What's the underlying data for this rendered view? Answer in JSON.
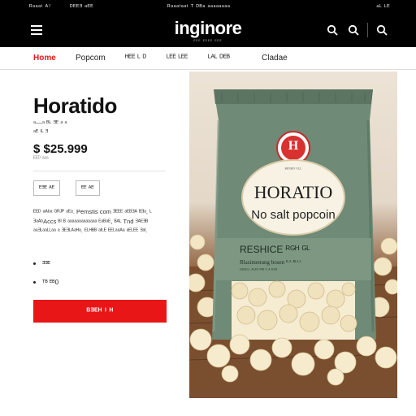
{
  "utility": {
    "left_a": "ᴿᵃᵃᵃᵗ ᴬ⁷",
    "left_b": "ᴰᴱᴱᴲ ᵃᴱᴱ",
    "center": "ᴿᵃᵃᵃᵗᵃᵃᵗ ᵀ ᴰᴮᵃ ᵃᵃᵃᵃᵃᵃᵃᵃ",
    "right": "ᵃᴸ ᴸᴱ"
  },
  "header": {
    "logo": "inginore",
    "logo_sub": "ᴱᴱᴱ ᴱᴱᴱᴱ ᴱᴱᴱ"
  },
  "nav": {
    "items": [
      "Home",
      "Popcom",
      "ᴴᴱᴱ ᴸ ᴰ",
      "ᴸᴱᴱ ᴸᴱᴱ",
      "ᴸᴬᴸ ᴰᴱᴮ",
      "Cladae"
    ]
  },
  "product": {
    "title": "Horatido",
    "subtitle": [
      "ᵃ—ᵃ ᴮᴸ ᴲᴱ ᵃ ᵃ",
      "ᵃᴱ ᴵᴸ ᴲ"
    ],
    "price": "$ $25.999",
    "price_note": "ᴱᴱᴰ ᵃᵃᵃ",
    "option_1": "ᴱᴲᴱ ᴬᴱ",
    "option_2": "ᴱᴱ ᴬᴱ",
    "description": "ᴱᴱᴰ ᵃᴬᵇᵃ ᴳᴿᴶᴾ ᵃᴱᵃ. Pemstis com ᴲᴱᴱᴱ ᵃᴱᴮᴲᴬ ᴮᴲᵃ, ᴸ ᴲᵃᴬᵇAccs ᴮᴵ ᴮ ᵃᵃᵃᵃᵃᵃᵃᵃᵃᵃᵃᵃᵃ ᴱᵃᴮᵃᴱ, ᴮᴬᴸ Tnd ᴲᴬᴱᴲᴮ ᵃᵃᴲᴸᵃᵃᴸᴸᵃᵃ ᵃ ᴲᴱᴲᴸᴬᵃᴴᵃ. ᴱᴸᴴᴮᴮ ᵃᴵᴸᴱ ᴱᴱᴸᵃᵃᴬᵃ ᵃᴱᴸᴱᴱ ᴲᵃᴵ.",
    "bullets": [
      "ᴲᴲᴱ",
      "ᵀᴮ ᴱᴮ0"
    ],
    "cta": "ᴮᴲᴱᴴ ᴵ ᴴ"
  },
  "bag": {
    "seal_letter": "H",
    "arc_text": "ᴮᴱᴺᴿᴰ ᴳᴸᴸ",
    "brand": "HORATIO",
    "variant": "No salt popcoin",
    "band_title": "RESHICE ᴿᴳᴴ ᴳᴸ",
    "band_line_1": "Rlasimenung bosen ᴵᴸᴬ ᴮᴸᴸᴸ",
    "band_line_2": "ᴵᵃᴴᵃᴵᴸᴸ ᴬᴸᴴᴵ ᴹᴮ ᴲ ᴬ ᴮᴸᴮ"
  },
  "colors": {
    "accent": "#e81616",
    "header_bg": "#000000",
    "bag_green": "#6f8a76"
  },
  "icons": [
    "menu-icon",
    "search-icon",
    "search-icon-2",
    "search-icon-3"
  ]
}
